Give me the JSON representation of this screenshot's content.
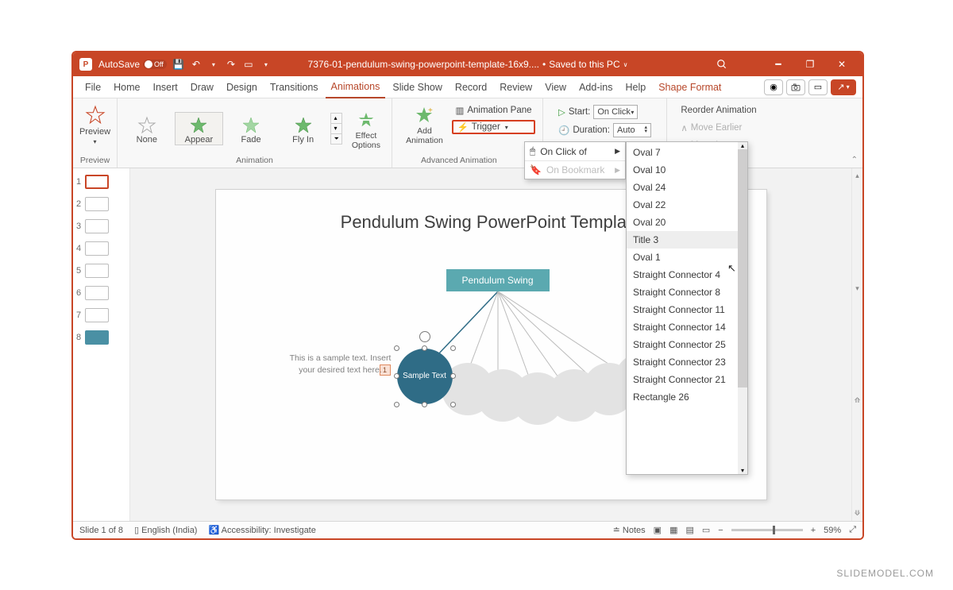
{
  "titlebar": {
    "autosave_label": "AutoSave",
    "autosave_state": "Off",
    "filename": "7376-01-pendulum-swing-powerpoint-template-16x9....",
    "saved_state": "Saved to this PC"
  },
  "tabs": [
    "File",
    "Home",
    "Insert",
    "Draw",
    "Design",
    "Transitions",
    "Animations",
    "Slide Show",
    "Record",
    "Review",
    "View",
    "Add-ins",
    "Help",
    "Shape Format"
  ],
  "active_tab": "Animations",
  "context_tab": "Shape Format",
  "ribbon": {
    "preview_btn": "Preview",
    "preview_grp": "Preview",
    "effects": [
      "None",
      "Appear",
      "Fade",
      "Fly In"
    ],
    "selected_effect": "Appear",
    "effect_options": "Effect Options",
    "animation_grp": "Animation",
    "add_animation": "Add Animation",
    "advanced_grp": "Advanced Animation",
    "anim_pane": "Animation Pane",
    "trigger": "Trigger",
    "start_label": "Start:",
    "start_value": "On Click",
    "duration_label": "Duration:",
    "duration_value": "Auto",
    "reorder_label": "Reorder Animation",
    "move_earlier": "Move Earlier",
    "move_later": "Move Later"
  },
  "flyout1": {
    "on_click_of": "On Click of",
    "on_bookmark": "On Bookmark"
  },
  "trigger_options": [
    "Oval 7",
    "Oval 10",
    "Oval 24",
    "Oval 22",
    "Oval 20",
    "Title 3",
    "Oval 1",
    "Straight Connector 4",
    "Straight Connector 8",
    "Straight Connector 11",
    "Straight Connector 14",
    "Straight Connector 25",
    "Straight Connector 23",
    "Straight Connector 21",
    "Rectangle 26"
  ],
  "highlighted_option": "Title 3",
  "slide": {
    "title": "Pendulum Swing PowerPoint Template",
    "teal_label": "Pendulum Swing",
    "circle_label": "Sample Text",
    "sample_text": "This is a sample text. Insert your desired text here.",
    "anim_tag": "1"
  },
  "thumbnails": [
    1,
    2,
    3,
    4,
    5,
    6,
    7,
    8
  ],
  "selected_thumb": 1,
  "status": {
    "slide_pos": "Slide 1 of 8",
    "language": "English (India)",
    "accessibility": "Accessibility: Investigate",
    "notes": "Notes",
    "zoom": "59%"
  },
  "watermark": "SLIDEMODEL.COM"
}
